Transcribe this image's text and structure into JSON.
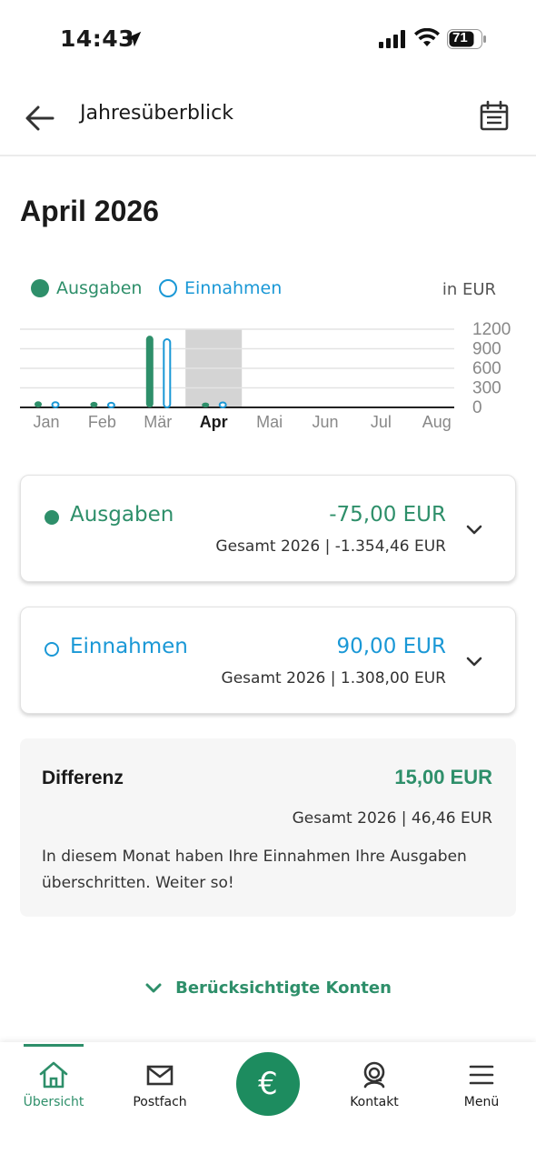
{
  "status": {
    "time": "14:43",
    "battery": "71"
  },
  "header": {
    "title": "Jahresüberblick"
  },
  "month_title": "April 2026",
  "legend": {
    "ausgaben": "Ausgaben",
    "einnahmen": "Einnahmen",
    "unit": "in EUR"
  },
  "colors": {
    "ausgaben": "#2e8f6a",
    "einnahmen": "#1a98d6",
    "selected_bg": "#d4d4d4",
    "primary": "#1d8c5f"
  },
  "chart_data": {
    "type": "bar",
    "categories": [
      "Jan",
      "Feb",
      "Mär",
      "Apr",
      "Mai",
      "Jun",
      "Jul",
      "Aug"
    ],
    "series": [
      {
        "name": "Ausgaben",
        "values": [
          95,
          85,
          1100,
          75,
          null,
          null,
          null,
          null
        ]
      },
      {
        "name": "Einnahmen",
        "values": [
          95,
          85,
          1060,
          90,
          null,
          null,
          null,
          null
        ]
      }
    ],
    "selected_category": "Apr",
    "yticks": [
      "1200",
      "900",
      "600",
      "300",
      "0"
    ],
    "ylim": [
      0,
      1200
    ],
    "grid": true,
    "legend": "top-left"
  },
  "cards": {
    "ausgaben": {
      "label": "Ausgaben",
      "value": "-75,00 EUR",
      "total": "Gesamt 2026 | -1.354,46 EUR"
    },
    "einnahmen": {
      "label": "Einnahmen",
      "value": "90,00 EUR",
      "total": "Gesamt 2026 | 1.308,00 EUR"
    }
  },
  "differenz": {
    "label": "Differenz",
    "value": "15,00 EUR",
    "total": "Gesamt 2026 | 46,46 EUR",
    "message": "In diesem Monat haben Ihre Einnahmen Ihre Ausgaben überschritten. Weiter so!"
  },
  "konten_link": "Berücksichtigte Konten",
  "nav": {
    "uebersicht": "Übersicht",
    "postfach": "Postfach",
    "euro": "€",
    "kontakt": "Kontakt",
    "menu": "Menü"
  },
  "icons": {
    "back": "arrow-left-icon",
    "calendar": "calendar-icon",
    "home": "home-icon",
    "mail": "mail-icon",
    "euro": "euro-icon",
    "headset": "headset-icon",
    "menu": "hamburger-icon"
  }
}
